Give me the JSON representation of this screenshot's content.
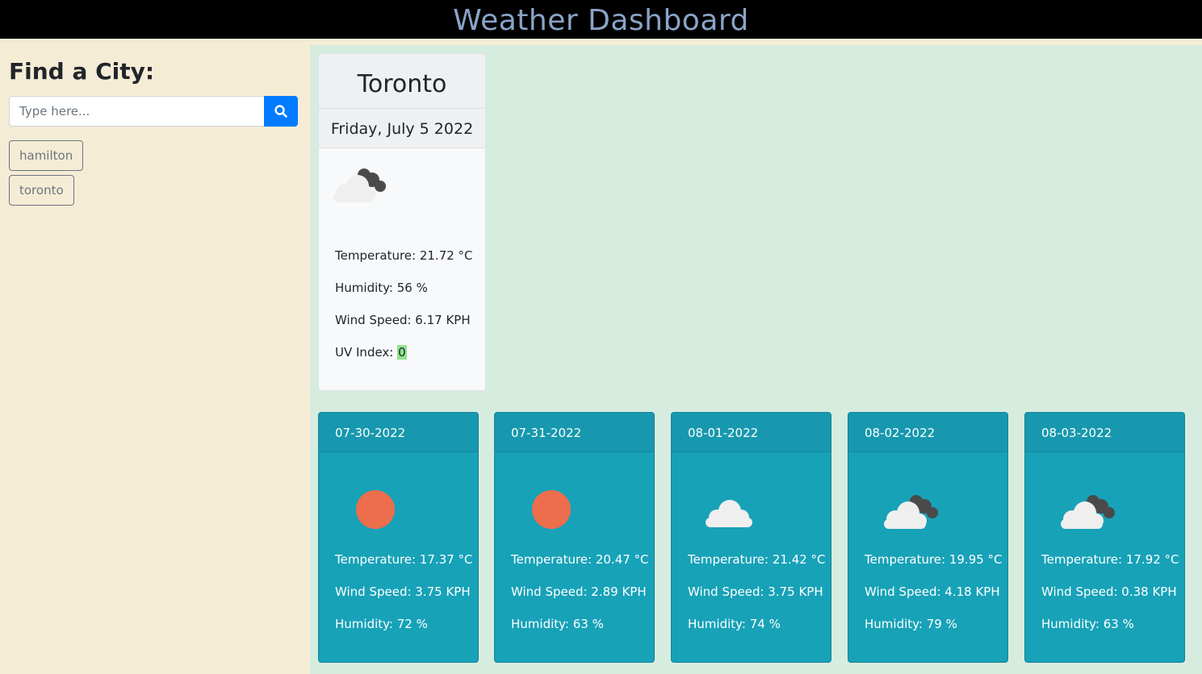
{
  "header": {
    "title": "Weather Dashboard"
  },
  "sidebar": {
    "heading": "Find a City:",
    "search": {
      "placeholder": "Type here...",
      "value": ""
    },
    "history": [
      "hamilton",
      "toronto"
    ]
  },
  "current": {
    "city": "Toronto",
    "date": "Friday, July 5 2022",
    "icon": "broken-clouds-icon",
    "temperature": "Temperature: 21.72 °C",
    "humidity": "Humidity: 56 %",
    "wind": "Wind Speed: 6.17 KPH",
    "uv_label": "UV Index: ",
    "uv_value": "0",
    "uv_color": "#8fe38f"
  },
  "forecast": [
    {
      "date": "07-30-2022",
      "icon": "clear-sky-icon",
      "temperature": "Temperature: 17.37 °C",
      "wind": "Wind Speed: 3.75 KPH",
      "humidity": "Humidity: 72 %"
    },
    {
      "date": "07-31-2022",
      "icon": "clear-sky-icon",
      "temperature": "Temperature: 20.47 °C",
      "wind": "Wind Speed: 2.89 KPH",
      "humidity": "Humidity: 63 %"
    },
    {
      "date": "08-01-2022",
      "icon": "few-clouds-icon",
      "temperature": "Temperature: 21.42 °C",
      "wind": "Wind Speed: 3.75 KPH",
      "humidity": "Humidity: 74 %"
    },
    {
      "date": "08-02-2022",
      "icon": "broken-clouds-icon",
      "temperature": "Temperature: 19.95 °C",
      "wind": "Wind Speed: 4.18 KPH",
      "humidity": "Humidity: 79 %"
    },
    {
      "date": "08-03-2022",
      "icon": "broken-clouds-icon",
      "temperature": "Temperature: 17.92 °C",
      "wind": "Wind Speed: 0.38 KPH",
      "humidity": "Humidity: 63 %"
    }
  ],
  "colors": {
    "accent": "#007bff",
    "forecast_card": "#17a2b8",
    "sun": "#ec6e4c"
  }
}
